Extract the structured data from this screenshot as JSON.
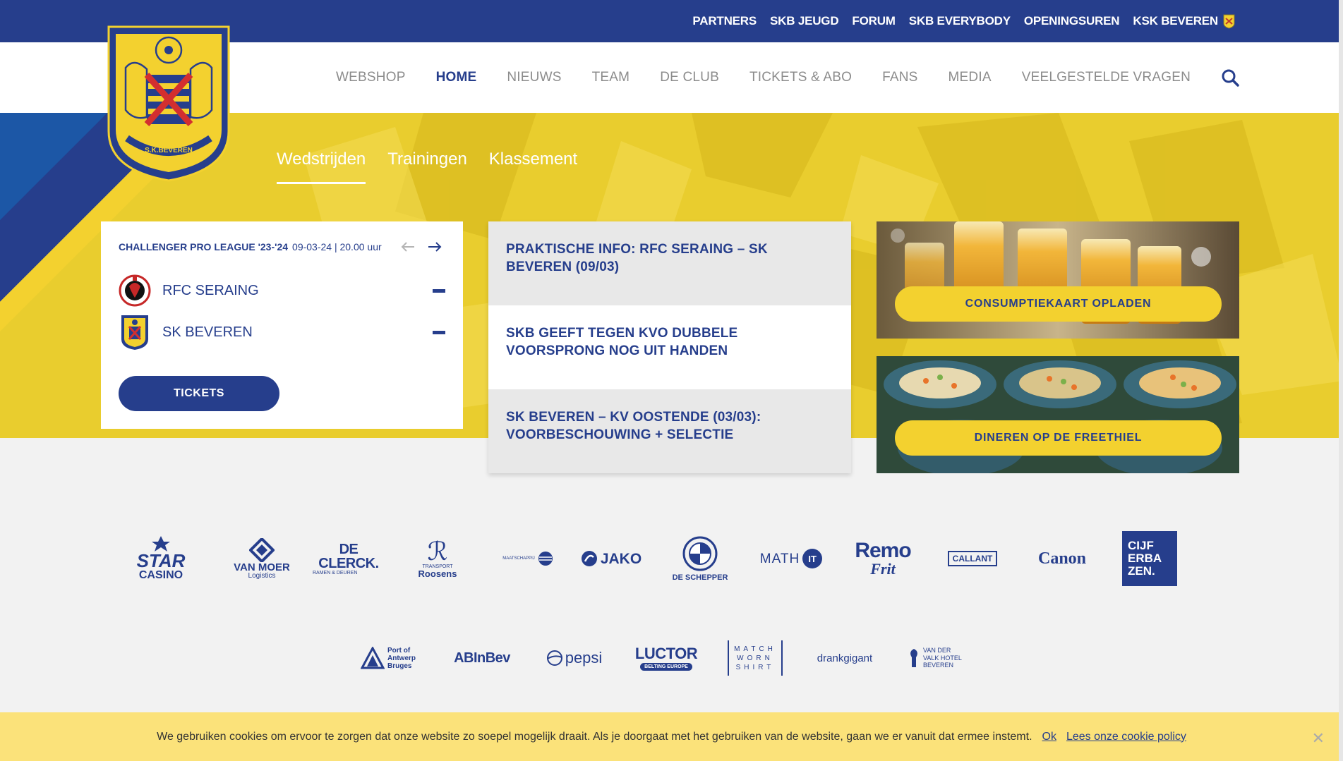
{
  "topnav": {
    "items": [
      "PARTNERS",
      "SKB JEUGD",
      "FORUM",
      "SKB EVERYBODY",
      "OPENINGSUREN",
      "KSK BEVEREN"
    ]
  },
  "mainnav": {
    "items": [
      "WEBSHOP",
      "HOME",
      "NIEUWS",
      "TEAM",
      "DE CLUB",
      "TICKETS & ABO",
      "FANS",
      "MEDIA",
      "VEELGESTELDE VRAGEN"
    ],
    "active": "HOME"
  },
  "colors": {
    "navy": "#263e8c",
    "yellow": "#f3d12f",
    "hero": "#e9cd2e",
    "cookie": "#fbe27a"
  },
  "subtabs": [
    "Wedstrijden",
    "Trainingen",
    "Klassement"
  ],
  "match": {
    "competition": "CHALLENGER PRO LEAGUE '23-'24",
    "datetime": "09-03-24 | 20.00 uur",
    "home": "RFC SERAING",
    "away": "SK BEVEREN",
    "tickets_label": "TICKETS"
  },
  "news": [
    "PRAKTISCHE INFO: RFC SERAING – SK BEVEREN (09/03)",
    "SKB GEEFT TEGEN KVO DUBBELE VOORSPRONG NOG UIT HANDEN",
    "SK BEVEREN – KV OOSTENDE (03/03): VOORBESCHOUWING + SELECTIE"
  ],
  "promos": [
    "CONSUMPTIEKAART OPLADEN",
    "DINEREN OP DE FREETHIEL"
  ],
  "sponsors_row1": {
    "starcasino_a": "STAR",
    "starcasino_b": "CASINO",
    "vanmoer_a": "VAN MOER",
    "vanmoer_b": "Logistics",
    "declerck_a": "DE CLERCK.",
    "declerck_b": "RAMEN & DEUREN",
    "roosens_a": "TRANSPORT",
    "roosens_b": "Roosens",
    "mu": "MAATSCHAPPIJ",
    "jako": "JAKO",
    "schepper": "DE SCHEPPER",
    "mathit_a": "MATH",
    "mathit_b": "IT",
    "remo_a": "Remo",
    "remo_b": "Frit",
    "callant": "CALLANT",
    "canon": "Canon",
    "cijfer": "CIJF ERBA ZEN."
  },
  "sponsors_row2": {
    "port": "Port of Antwerp Bruges",
    "abinbev": "ABInBev",
    "pepsi": "pepsi",
    "luctor_a": "LUCTOR",
    "luctor_b": "BELTING  EUROPE",
    "mws": "MATCH WORN SHIRT",
    "drank": "drankgigant",
    "valk": "VAN DER VALK HOTEL BEVEREN"
  },
  "cookie": {
    "text": "We gebruiken cookies om ervoor te zorgen dat onze website zo soepel mogelijk draait. Als je doorgaat met het gebruiken van de website, gaan we er vanuit dat ermee instemt.",
    "ok": "Ok",
    "policy": "Lees onze cookie policy",
    "close": "✕"
  }
}
